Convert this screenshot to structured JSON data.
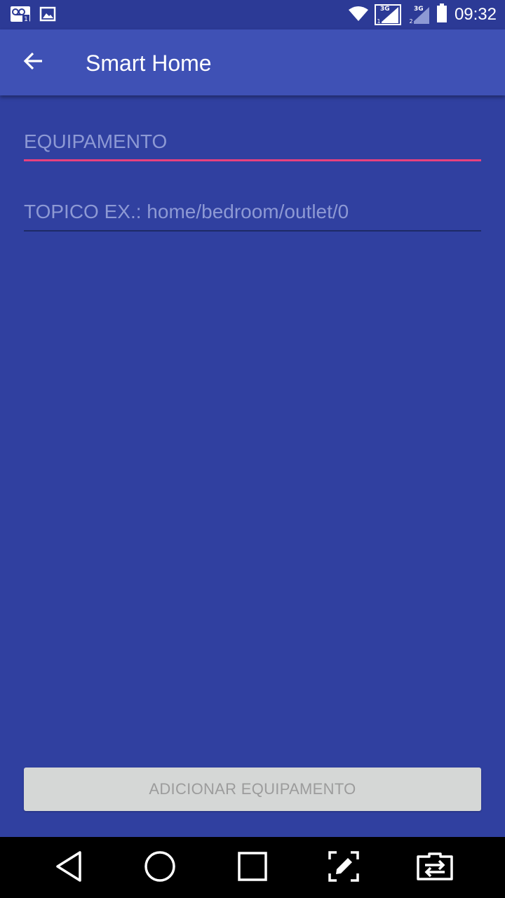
{
  "status_bar": {
    "time": "09:32",
    "left_icons": [
      "voicemail-sim1-icon",
      "image-icon"
    ],
    "right_icons": [
      "wifi-icon",
      "signal-3g-sim1-icon",
      "signal-3g-sim2-icon",
      "battery-icon"
    ],
    "sim1_label": "3G",
    "sim2_label": "3G"
  },
  "app_bar": {
    "title": "Smart Home",
    "back_icon": "arrow-back-icon"
  },
  "form": {
    "equipment_placeholder": "EQUIPAMENTO",
    "equipment_value": "",
    "topic_placeholder": "TOPICO EX.: home/bedroom/outlet/0",
    "topic_value": "",
    "add_button_label": "ADICIONAR EQUIPAMENTO"
  },
  "nav_bar": {
    "buttons": [
      "back-triangle-icon",
      "home-circle-icon",
      "recents-square-icon",
      "screenshot-edit-icon",
      "switch-app-icon"
    ]
  },
  "colors": {
    "background": "#3040a0",
    "app_bar": "#3f51b5",
    "status_bar": "#2c3a96",
    "accent": "#e8417e",
    "placeholder": "#8d99d4",
    "button_disabled_bg": "#d5d7d6",
    "button_disabled_text": "#9c9c9c"
  }
}
